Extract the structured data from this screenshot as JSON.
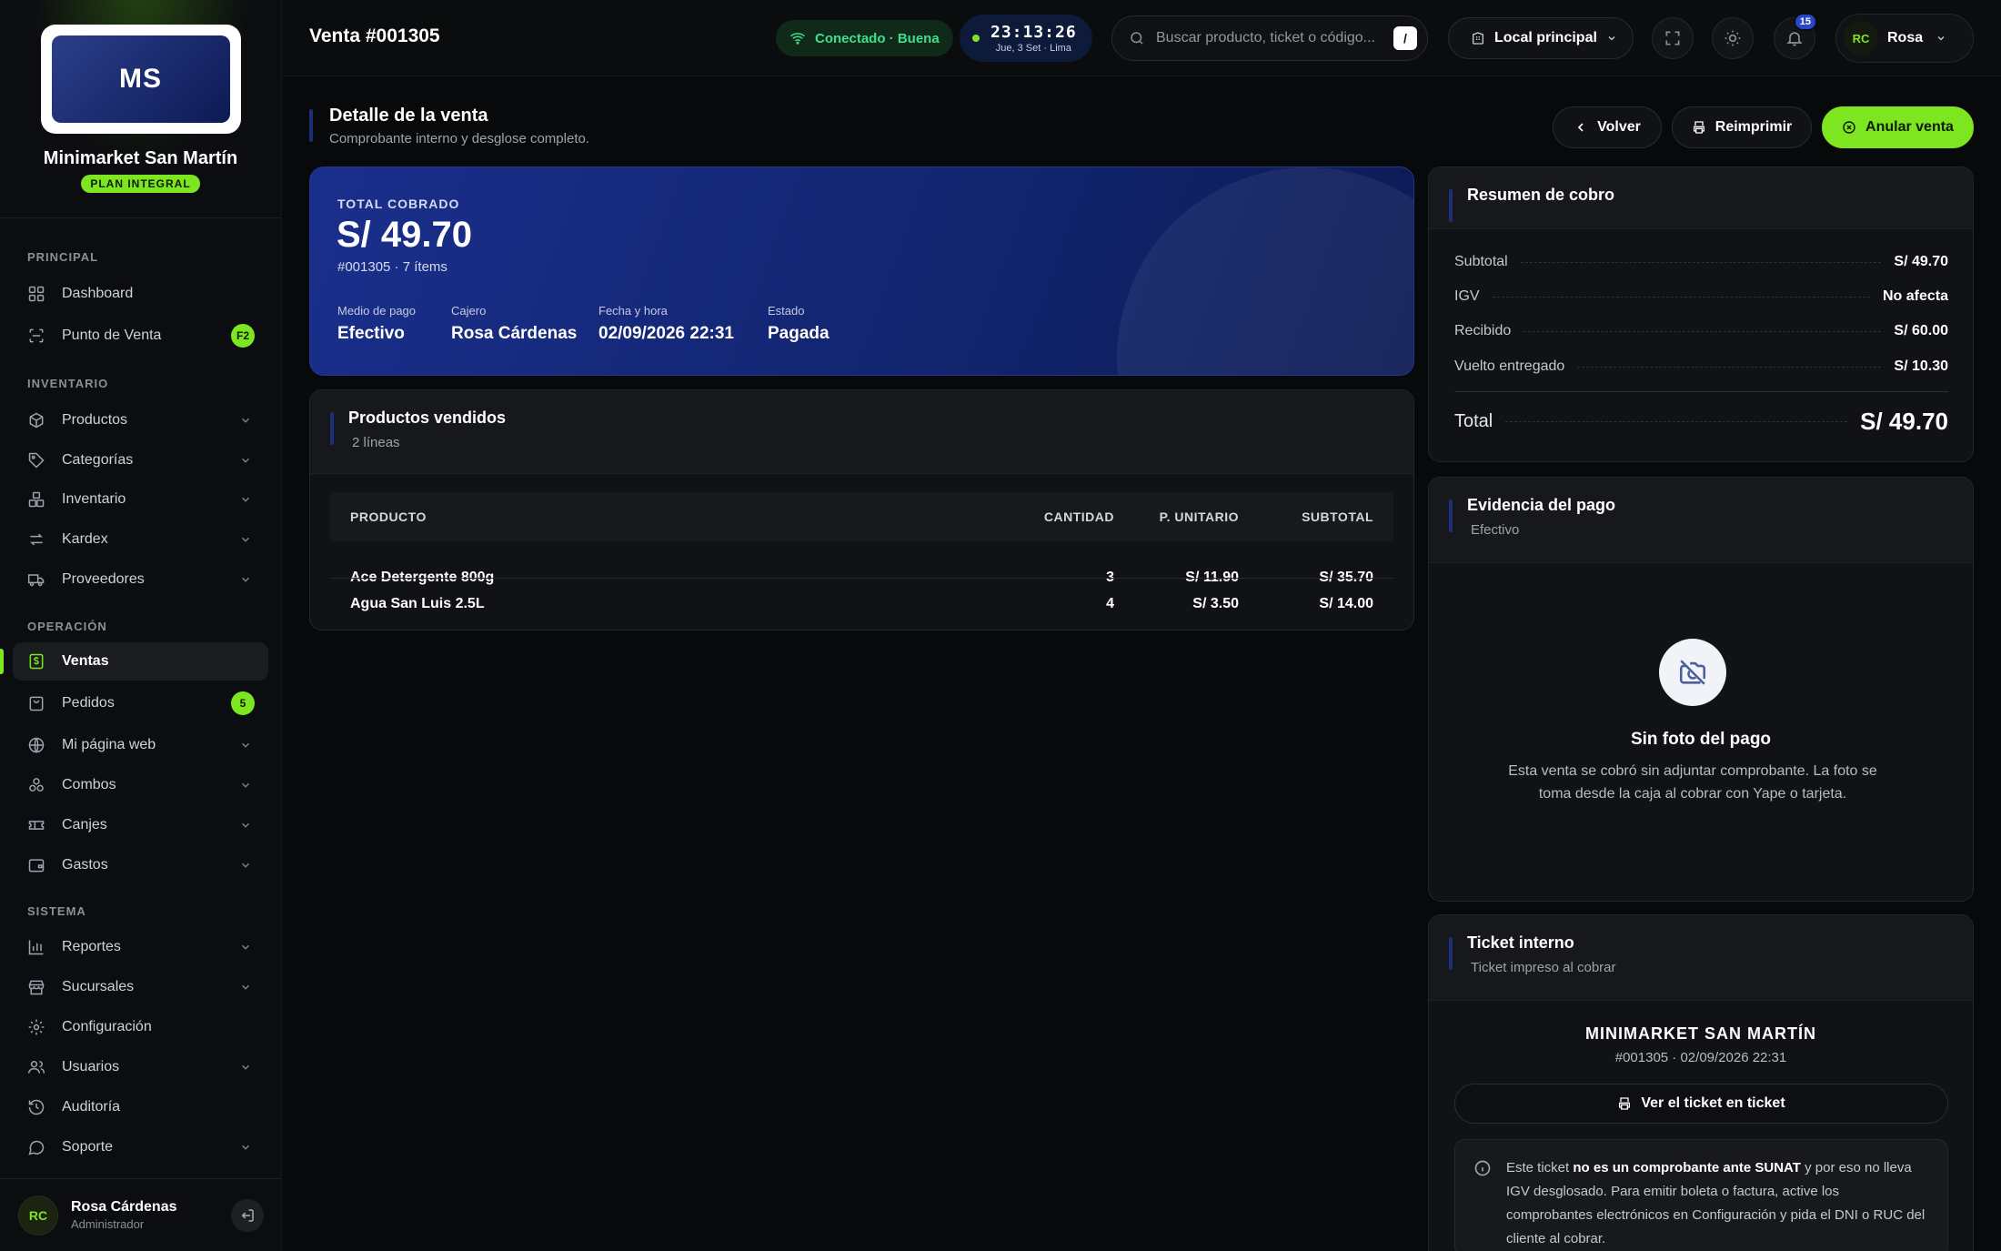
{
  "brand": {
    "logo_text": "MS",
    "store_name": "Minimarket San Martín",
    "plan": "PLAN INTEGRAL"
  },
  "nav": {
    "sections": {
      "principal": "PRINCIPAL",
      "inventario": "INVENTARIO",
      "operacion": "OPERACIÓN",
      "sistema": "SISTEMA"
    },
    "items": {
      "dashboard": "Dashboard",
      "pos": "Punto de Venta",
      "pos_shortcut": "F2",
      "productos": "Productos",
      "categorias": "Categorías",
      "inventario": "Inventario",
      "kardex": "Kardex",
      "proveedores": "Proveedores",
      "ventas": "Ventas",
      "pedidos": "Pedidos",
      "pedidos_count": "5",
      "mi_pagina": "Mi página web",
      "combos": "Combos",
      "canjes": "Canjes",
      "gastos": "Gastos",
      "reportes": "Reportes",
      "sucursales": "Sucursales",
      "configuracion": "Configuración",
      "usuarios": "Usuarios",
      "auditoria": "Auditoría",
      "soporte": "Soporte"
    }
  },
  "user": {
    "initials": "RC",
    "name": "Rosa Cárdenas",
    "role": "Administrador",
    "short_name": "Rosa"
  },
  "header": {
    "title": "Venta #001305",
    "connection": "Conectado · Buena",
    "clock_time": "23:13:26",
    "clock_date": "Jue, 3 Set · Lima",
    "search_placeholder": "Buscar producto, ticket o código...",
    "search_shortcut": "/",
    "branch": "Local principal",
    "notifications": "15"
  },
  "detail": {
    "title": "Detalle de la venta",
    "subtitle": "Comprobante interno y desglose completo.",
    "back": "Volver",
    "reprint": "Reimprimir",
    "void": "Anular venta"
  },
  "hero": {
    "label": "TOTAL COBRADO",
    "total": "S/ 49.70",
    "sub": "#001305 · 7 ítems",
    "fields": [
      {
        "label": "Medio de pago",
        "value": "Efectivo"
      },
      {
        "label": "Cajero",
        "value": "Rosa Cárdenas"
      },
      {
        "label": "Fecha y hora",
        "value": "02/09/2026 22:31"
      },
      {
        "label": "Estado",
        "value": "Pagada"
      }
    ]
  },
  "products": {
    "title": "Productos vendidos",
    "subtitle": "2 líneas",
    "columns": [
      "PRODUCTO",
      "CANTIDAD",
      "P. UNITARIO",
      "SUBTOTAL"
    ],
    "rows": [
      {
        "name": "Ace Detergente 800g",
        "qty": "3",
        "unit": "S/ 11.90",
        "subtotal": "S/ 35.70"
      },
      {
        "name": "Agua San Luis 2.5L",
        "qty": "4",
        "unit": "S/ 3.50",
        "subtotal": "S/ 14.00"
      }
    ]
  },
  "summary": {
    "title": "Resumen de cobro",
    "rows": [
      {
        "label": "Subtotal",
        "value": "S/ 49.70"
      },
      {
        "label": "IGV",
        "value": "No afecta"
      },
      {
        "label": "Recibido",
        "value": "S/ 60.00"
      },
      {
        "label": "Vuelto entregado",
        "value": "S/ 10.30"
      }
    ],
    "total_label": "Total",
    "total_value": "S/ 49.70"
  },
  "evidence": {
    "title": "Evidencia del pago",
    "subtitle": "Efectivo",
    "empty_title": "Sin foto del pago",
    "empty_text": "Esta venta se cobró sin adjuntar comprobante. La foto se toma desde la caja al cobrar con Yape o tarjeta."
  },
  "ticket": {
    "title": "Ticket interno",
    "subtitle": "Ticket impreso al cobrar",
    "store": "MINIMARKET SAN MARTÍN",
    "meta": "#001305 · 02/09/2026 22:31",
    "button": "Ver el ticket en ticket",
    "note_before": "Este ticket ",
    "note_bold": "no es un comprobante ante SUNAT",
    "note_after": " y por eso no lleva IGV desglosado. Para emitir boleta o factura, active los comprobantes electrónicos en Configuración y pida el DNI o RUC del cliente al cobrar."
  },
  "colors": {
    "accent": "#7ee521",
    "hero_blue": "#1a2f8c",
    "background": "#08090b"
  }
}
